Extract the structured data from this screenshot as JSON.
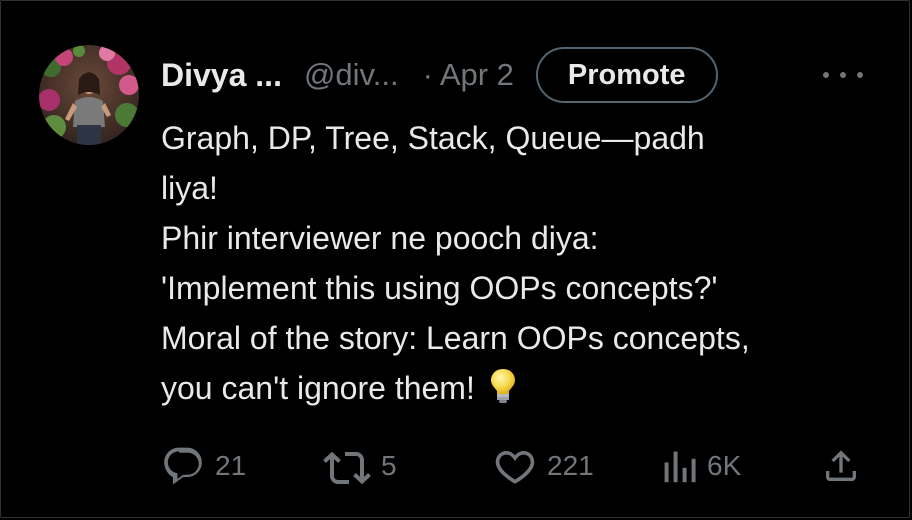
{
  "author": {
    "display_name": "Divya ...",
    "handle": "@div...",
    "date": "· Apr 2"
  },
  "buttons": {
    "promote_label": "Promote"
  },
  "tweet": {
    "lines": [
      "Graph, DP, Tree, Stack, Queue—padh",
      "liya!",
      "Phir interviewer ne pooch diya:",
      "'Implement this using OOPs concepts?'",
      "Moral of the story: Learn OOPs concepts,",
      "you can't ignore them!"
    ],
    "emoji": "lightbulb"
  },
  "metrics": {
    "replies": "21",
    "reposts": "5",
    "likes": "221",
    "views": "6K"
  },
  "icons": {
    "reply": "reply-icon",
    "repost": "repost-icon",
    "like": "heart-icon",
    "views": "views-icon",
    "share": "share-icon",
    "more": "more-icon"
  },
  "colors": {
    "background": "#000000",
    "text_primary": "#e7e9ea",
    "text_secondary": "#71767b",
    "button_border": "#536471"
  }
}
